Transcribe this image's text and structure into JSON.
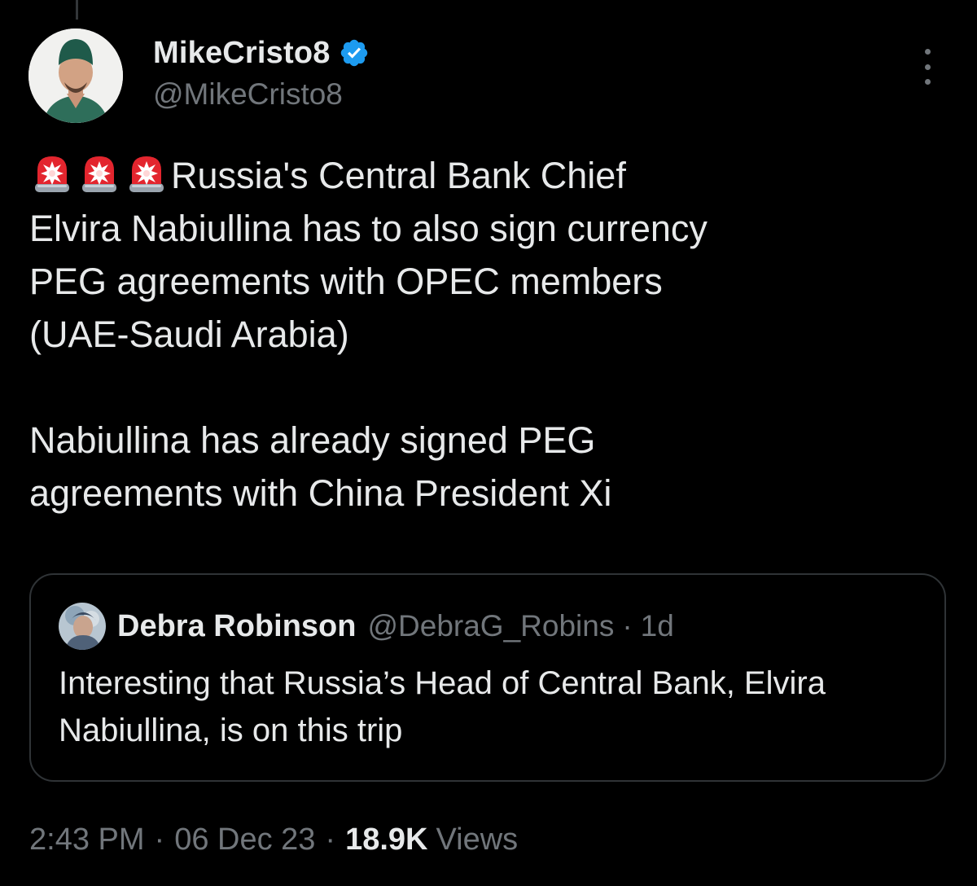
{
  "tweet": {
    "author": {
      "display_name": "MikeCristo8",
      "handle": "@MikeCristo8",
      "verified": true,
      "verified_color": "#1d9bf0"
    },
    "emoji": [
      "rotating-light",
      "rotating-light",
      "rotating-light"
    ],
    "text_line_1": "Russia's Central Bank Chief",
    "text_rest": "Elvira Nabiullina has to also sign currency\nPEG agreements with OPEC members\n(UAE-Saudi Arabia)\n\nNabiullina has already signed PEG\nagreements with China President Xi",
    "quoted": {
      "display_name": "Debra Robinson",
      "handle": "@DebraG_Robins",
      "separator": "·",
      "time": "1d",
      "text": "Interesting that Russia’s Head of Central Bank, Elvira Nabiullina, is on this trip"
    },
    "meta": {
      "time": "2:43 PM",
      "separator": "·",
      "date": "06 Dec 23",
      "views_count": "18.9K",
      "views_label": "Views"
    }
  },
  "colors": {
    "background": "#000000",
    "text_primary": "#e7e9ea",
    "text_secondary": "#71767b",
    "border": "#2f3336",
    "accent": "#1d9bf0"
  }
}
